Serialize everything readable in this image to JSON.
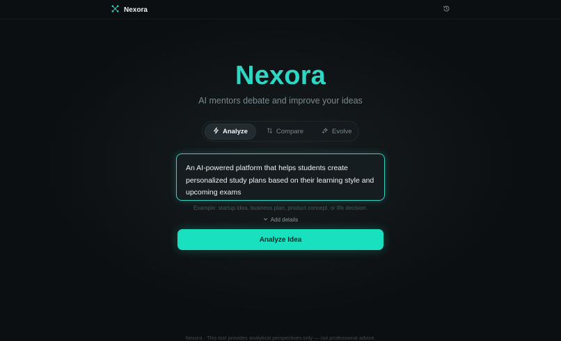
{
  "app": {
    "brand": "Nexora"
  },
  "header": {
    "logo_icon": "network-nodes-icon",
    "history_icon": "history-icon"
  },
  "hero": {
    "title": "Nexora",
    "subtitle": "AI mentors debate and improve your ideas"
  },
  "tabs": [
    {
      "label": "Analyze",
      "icon": "lightning-icon",
      "active": true
    },
    {
      "label": "Compare",
      "icon": "swap-arrows-icon",
      "active": false
    },
    {
      "label": "Evolve",
      "icon": "sparkles-icon",
      "active": false
    }
  ],
  "idea_input": {
    "value": "An AI-powered platform that helps students create personalized study plans based on their learning style and upcoming exams",
    "helper": "Example: startup idea, business plan, product concept, or life decision."
  },
  "add_details": {
    "label": "Add details",
    "icon": "chevron-down-icon"
  },
  "primary_action": {
    "label": "Analyze Idea"
  },
  "footer": {
    "text": "Nexora · This tool provides analytical perspectives only — not professional advice."
  },
  "colors": {
    "accent": "#2fd6c3",
    "button": "#19e0bf",
    "background": "#0c0f11"
  }
}
